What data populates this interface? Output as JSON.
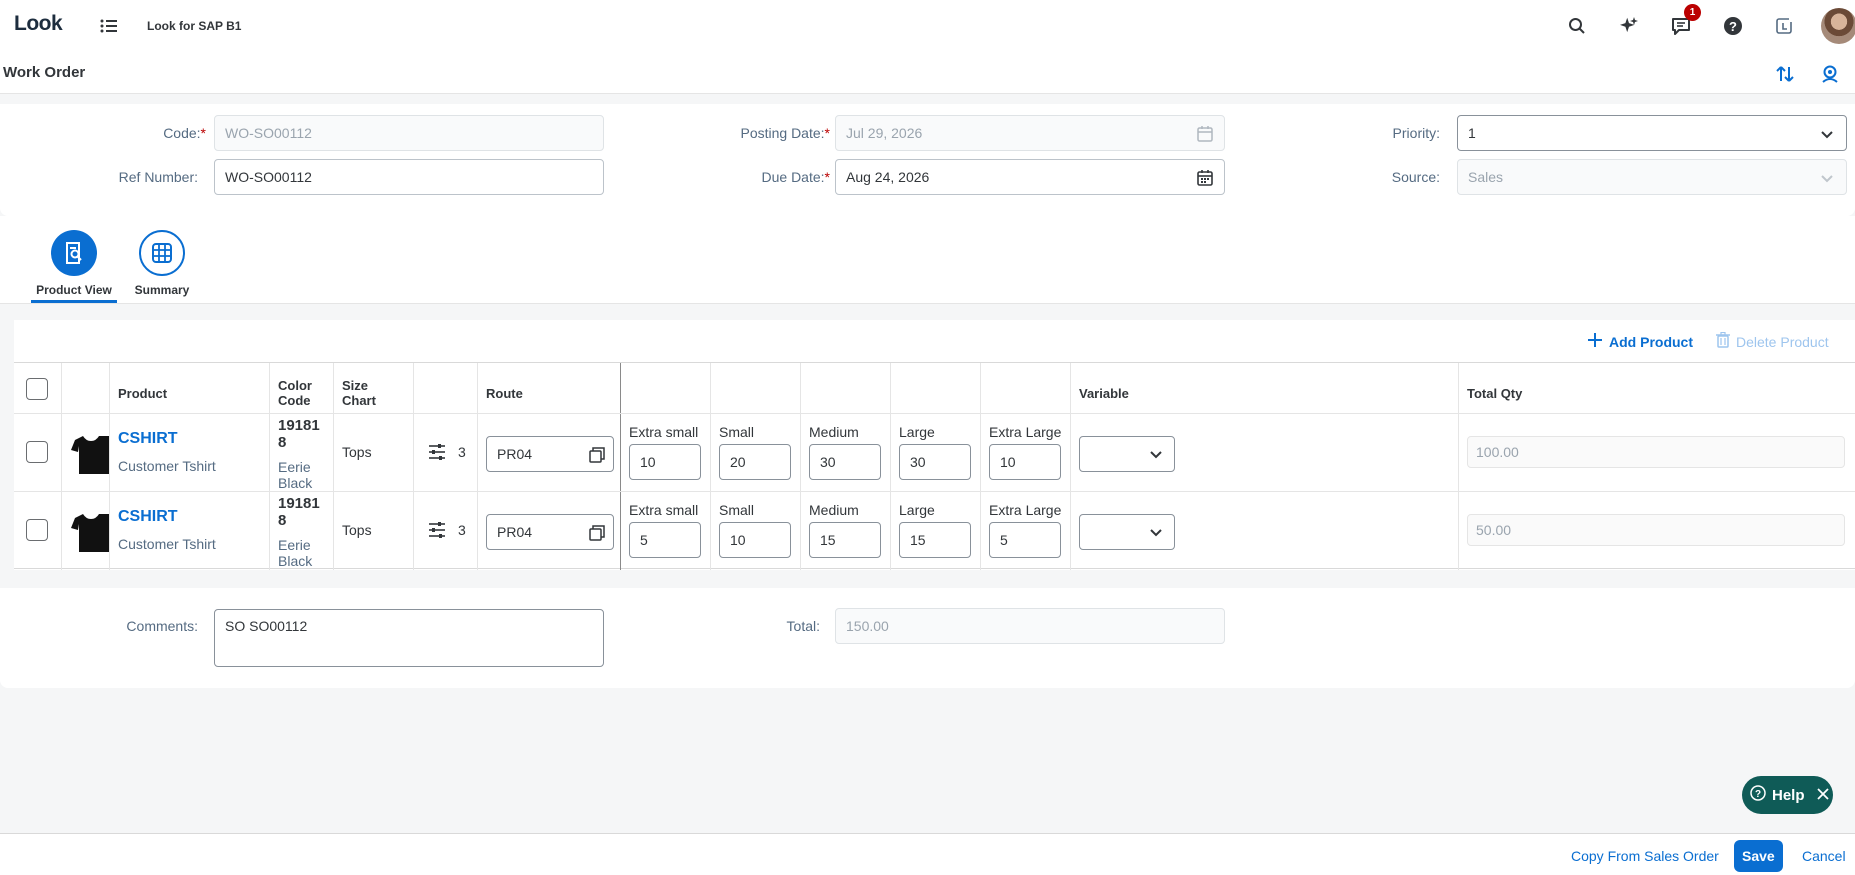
{
  "shell": {
    "logo": "Look",
    "app_title": "Look for SAP B1",
    "notification_count": "1"
  },
  "page": {
    "title": "Work Order"
  },
  "header": {
    "code_label": "Code:",
    "code_value": "WO-SO00112",
    "ref_label": "Ref Number:",
    "ref_value": "WO-SO00112",
    "posting_label": "Posting Date:",
    "posting_value": "Jul 29, 2026",
    "due_label": "Due Date:",
    "due_value": "Aug 24, 2026",
    "priority_label": "Priority:",
    "priority_value": "1",
    "source_label": "Source:",
    "source_value": "Sales"
  },
  "tabs": [
    {
      "label": "Product View"
    },
    {
      "label": "Summary"
    }
  ],
  "toolbar": {
    "add_label": "Add Product",
    "delete_label": "Delete Product"
  },
  "table": {
    "headers": {
      "product": "Product",
      "color_code": "Color Code",
      "size_chart": "Size Chart",
      "route": "Route",
      "variable": "Variable",
      "total_qty": "Total Qty"
    },
    "size_labels": [
      "Extra small",
      "Small",
      "Medium",
      "Large",
      "Extra Large"
    ],
    "rows": [
      {
        "product": "CSHIRT",
        "description": "Customer Tshirt",
        "color_code": "191818",
        "color_name": "Eerie Black",
        "size_chart": "Tops",
        "variant_count": "3",
        "route": "PR04",
        "sizes": [
          "10",
          "20",
          "30",
          "30",
          "10"
        ],
        "total_qty": "100.00"
      },
      {
        "product": "CSHIRT",
        "description": "Customer Tshirt",
        "color_code": "191818",
        "color_name": "Eerie Black",
        "size_chart": "Tops",
        "variant_count": "3",
        "route": "PR04",
        "sizes": [
          "5",
          "10",
          "15",
          "15",
          "5"
        ],
        "total_qty": "50.00"
      }
    ]
  },
  "footer": {
    "comments_label": "Comments:",
    "comments_value": "SO SO00112",
    "total_label": "Total:",
    "total_value": "150.00"
  },
  "help": {
    "label": "Help"
  },
  "actions": {
    "copy_label": "Copy From Sales Order",
    "save_label": "Save",
    "cancel_label": "Cancel"
  },
  "colors": {
    "brand": "#0a6ed1",
    "required": "#bb0000",
    "help_bg": "#0f5b57"
  }
}
